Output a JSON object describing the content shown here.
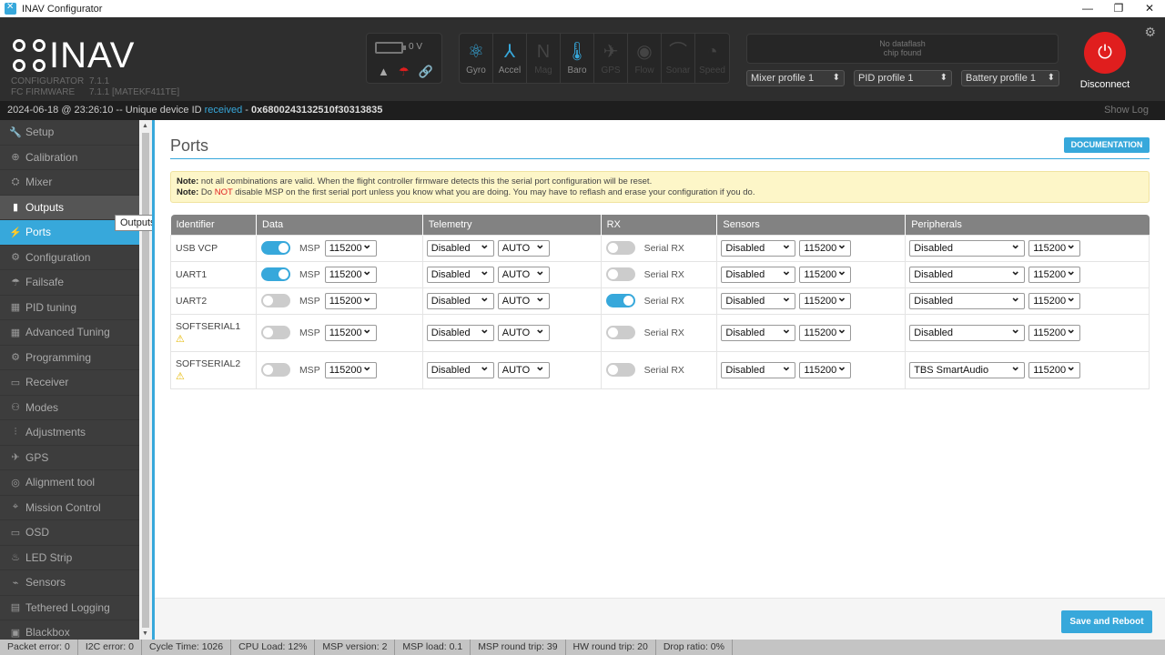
{
  "window": {
    "title": "INAV Configurator",
    "minimize": "—",
    "maximize": "❐",
    "close": "✕"
  },
  "header": {
    "logo_text": "INAV",
    "configurator_label": "CONFIGURATOR",
    "configurator_version": "7.1.1",
    "fc_label": "FC FIRMWARE",
    "fc_version": "7.1.1 [MATEKF411TE]",
    "battery_voltage": "0 V",
    "sensors": [
      {
        "name": "Gyro",
        "icon": "gyro-icon",
        "glyph": "⚛",
        "active": true
      },
      {
        "name": "Accel",
        "icon": "accel-icon",
        "glyph": "⅄",
        "active": true
      },
      {
        "name": "Mag",
        "icon": "mag-icon",
        "glyph": "N",
        "active": false
      },
      {
        "name": "Baro",
        "icon": "baro-icon",
        "glyph": "🌡",
        "active": true
      },
      {
        "name": "GPS",
        "icon": "gps-icon",
        "glyph": "✈",
        "active": false
      },
      {
        "name": "Flow",
        "icon": "flow-icon",
        "glyph": "◉",
        "active": false
      },
      {
        "name": "Sonar",
        "icon": "sonar-icon",
        "glyph": "⌒",
        "active": false
      },
      {
        "name": "Speed",
        "icon": "speed-icon",
        "glyph": "◔",
        "active": false
      }
    ],
    "dataflash_line1": "No dataflash",
    "dataflash_line2": "chip found",
    "mixer_profile": "Mixer profile 1",
    "pid_profile": "PID profile 1",
    "battery_profile": "Battery profile 1",
    "disconnect_label": "Disconnect"
  },
  "infobar": {
    "datetime": "2024-06-18 @ 23:26:10 -- Unique device ID ",
    "received": "received",
    "dash": " - ",
    "device_id": "0x6800243132510f30313835",
    "show_log": "Show Log"
  },
  "sidebar": {
    "items": [
      {
        "label": "Setup",
        "icon": "wrench-icon",
        "glyph": "🔧"
      },
      {
        "label": "Calibration",
        "icon": "crosshair-icon",
        "glyph": "⊕"
      },
      {
        "label": "Mixer",
        "icon": "mixer-icon",
        "glyph": "⛭"
      },
      {
        "label": "Outputs",
        "icon": "outputs-icon",
        "glyph": "▮"
      },
      {
        "label": "Ports",
        "icon": "plug-icon",
        "glyph": "⚡"
      },
      {
        "label": "Configuration",
        "icon": "gear-icon",
        "glyph": "⚙"
      },
      {
        "label": "Failsafe",
        "icon": "failsafe-icon",
        "glyph": "☂"
      },
      {
        "label": "PID tuning",
        "icon": "pid-icon",
        "glyph": "▦"
      },
      {
        "label": "Advanced Tuning",
        "icon": "advanced-icon",
        "glyph": "▦"
      },
      {
        "label": "Programming",
        "icon": "programming-icon",
        "glyph": "⚙"
      },
      {
        "label": "Receiver",
        "icon": "receiver-icon",
        "glyph": "▭"
      },
      {
        "label": "Modes",
        "icon": "modes-icon",
        "glyph": "⚇"
      },
      {
        "label": "Adjustments",
        "icon": "adjustments-icon",
        "glyph": "⫶"
      },
      {
        "label": "GPS",
        "icon": "gps-sidebar-icon",
        "glyph": "✈"
      },
      {
        "label": "Alignment tool",
        "icon": "alignment-icon",
        "glyph": "◎"
      },
      {
        "label": "Mission Control",
        "icon": "pin-icon",
        "glyph": "⌖"
      },
      {
        "label": "OSD",
        "icon": "osd-icon",
        "glyph": "▭"
      },
      {
        "label": "LED Strip",
        "icon": "led-icon",
        "glyph": "♨"
      },
      {
        "label": "Sensors",
        "icon": "sensors-icon",
        "glyph": "⌁"
      },
      {
        "label": "Tethered Logging",
        "icon": "tethered-icon",
        "glyph": "▤"
      },
      {
        "label": "Blackbox",
        "icon": "blackbox-icon",
        "glyph": "▣"
      }
    ],
    "tooltip": "Outputs"
  },
  "page": {
    "title": "Ports",
    "documentation": "DOCUMENTATION",
    "note1_label": "Note:",
    "note1_text": " not all combinations are valid. When the flight controller firmware detects this the serial port configuration will be reset.",
    "note2_label": "Note:",
    "note2_pre": " Do ",
    "note2_not": "NOT",
    "note2_text": " disable MSP on the first serial port unless you know what you are doing. You may have to reflash and erase your configuration if you do.",
    "columns": [
      "Identifier",
      "Data",
      "Telemetry",
      "RX",
      "Sensors",
      "Peripherals"
    ],
    "msp_label": "MSP",
    "serial_rx_label": "Serial RX",
    "rows": [
      {
        "id": "USB VCP",
        "warn": false,
        "msp": true,
        "msp_baud": "115200",
        "telemetry": "Disabled",
        "telemetry_baud": "AUTO",
        "rx": false,
        "sensors": "Disabled",
        "sensors_baud": "115200",
        "peripherals": "Disabled",
        "peripherals_baud": "115200"
      },
      {
        "id": "UART1",
        "warn": false,
        "msp": true,
        "msp_baud": "115200",
        "telemetry": "Disabled",
        "telemetry_baud": "AUTO",
        "rx": false,
        "sensors": "Disabled",
        "sensors_baud": "115200",
        "peripherals": "Disabled",
        "peripherals_baud": "115200"
      },
      {
        "id": "UART2",
        "warn": false,
        "msp": false,
        "msp_baud": "115200",
        "telemetry": "Disabled",
        "telemetry_baud": "AUTO",
        "rx": true,
        "sensors": "Disabled",
        "sensors_baud": "115200",
        "peripherals": "Disabled",
        "peripherals_baud": "115200"
      },
      {
        "id": "SOFTSERIAL1",
        "warn": true,
        "msp": false,
        "msp_baud": "115200",
        "telemetry": "Disabled",
        "telemetry_baud": "AUTO",
        "rx": false,
        "sensors": "Disabled",
        "sensors_baud": "115200",
        "peripherals": "Disabled",
        "peripherals_baud": "115200"
      },
      {
        "id": "SOFTSERIAL2",
        "warn": true,
        "msp": false,
        "msp_baud": "115200",
        "telemetry": "Disabled",
        "telemetry_baud": "AUTO",
        "rx": false,
        "sensors": "Disabled",
        "sensors_baud": "115200",
        "peripherals": "TBS SmartAudio",
        "peripherals_baud": "115200"
      }
    ],
    "save_reboot": "Save and Reboot"
  },
  "statusbar": [
    "Packet error: 0",
    "I2C error: 0",
    "Cycle Time: 1026",
    "CPU Load: 12%",
    "MSP version: 2",
    "MSP load: 0.1",
    "MSP round trip: 39",
    "HW round trip: 20",
    "Drop ratio: 0%"
  ],
  "colors": {
    "accent": "#37a8db",
    "danger": "#e01e1e",
    "header_bg": "#2e2e2e",
    "sidebar_bg": "#3d3d3d",
    "warning": "#e6b800"
  }
}
